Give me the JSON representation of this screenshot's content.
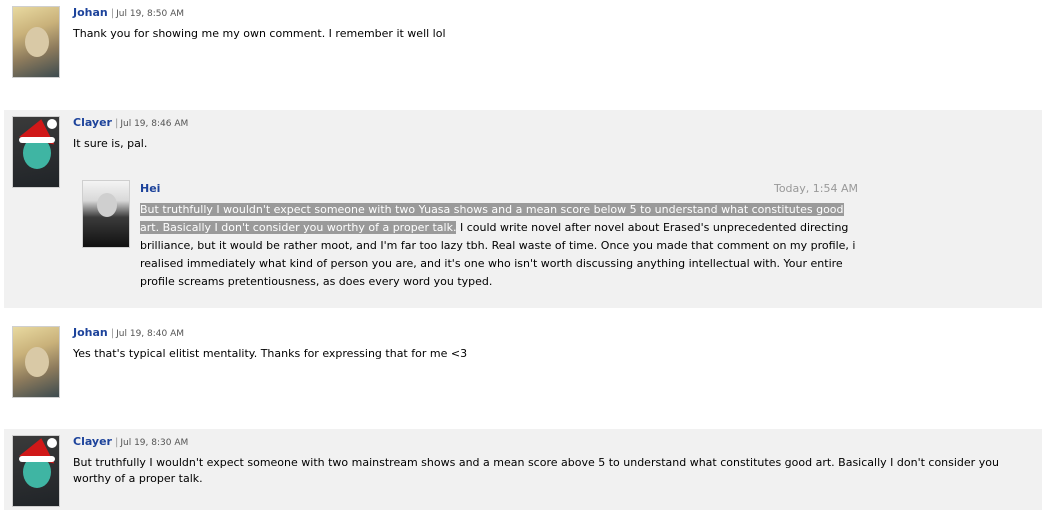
{
  "comments": [
    {
      "username": "Johan",
      "date": "Jul 19, 8:50 AM",
      "text": "Thank you for showing me my own comment. I remember it well lol"
    },
    {
      "username": "Clayer",
      "date": "Jul 19, 8:46 AM",
      "text": "It sure is, pal.",
      "quote": {
        "username": "Hei",
        "date": "Today, 1:54 AM",
        "highlighted_text": "But truthfully I wouldn't expect someone with two Yuasa shows and a mean score below 5 to understand what constitutes good art. Basically I don't consider you worthy of a proper talk.",
        "text": " I could write novel after novel about Erased's unprecedented directing brilliance, but it would be rather moot, and I'm far too lazy tbh. Real waste of time. Once you made that comment on my profile, i realised immediately what kind of person you are, and it's one who isn't worth discussing anything intellectual with. Your entire profile screams pretentiousness, as does every word you typed."
      }
    },
    {
      "username": "Johan",
      "date": "Jul 19, 8:40 AM",
      "text": "Yes that's typical elitist mentality. Thanks for expressing that for me <3"
    },
    {
      "username": "Clayer",
      "date": "Jul 19, 8:30 AM",
      "text": "But truthfully I wouldn't expect someone with two mainstream shows and a mean score above 5 to understand what constitutes good art. Basically I don't consider you worthy of a proper talk."
    }
  ],
  "separator": "|"
}
